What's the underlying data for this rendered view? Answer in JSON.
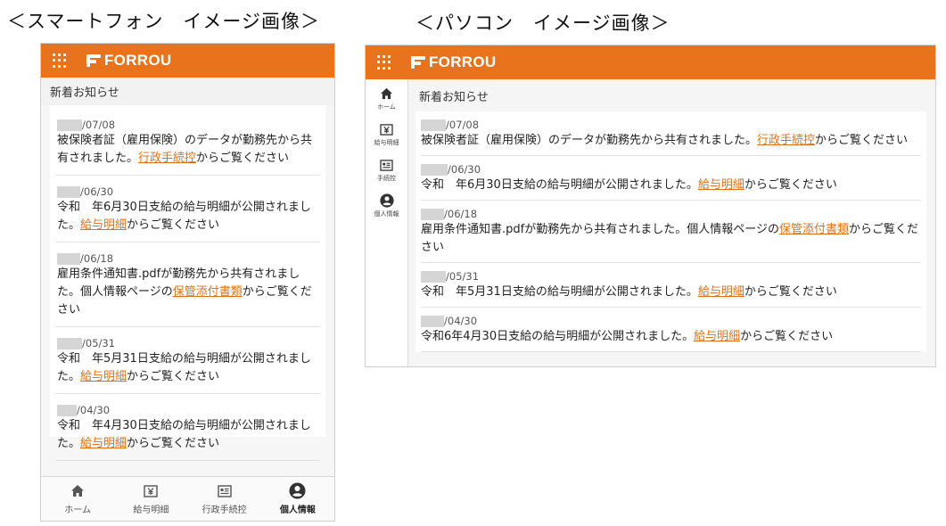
{
  "captions": {
    "mobile": "＜スマートフォン　イメージ画像＞",
    "pc": "＜パソコン　イメージ画像＞"
  },
  "brand": {
    "name": "FORROU",
    "color": "#e8731c"
  },
  "section_title": "新着お知らせ",
  "mobile": {
    "notices": [
      {
        "date": "/07/08",
        "before": "被保険者証（雇用保険）のデータが勤務先から共有されました。",
        "link": "行政手続控",
        "after": "からご覧ください"
      },
      {
        "date": "/06/30",
        "before": "令和　年6月30日支給の給与明細が公開されました。",
        "link": "給与明細",
        "after": "からご覧ください"
      },
      {
        "date": "/06/18",
        "before": "雇用条件通知書.pdfが勤務先から共有されました。個人情報ページの",
        "link": "保管添付書類",
        "after": "からご覧ください"
      },
      {
        "date": "/05/31",
        "before": "令和　年5月31日支給の給与明細が公開されました。",
        "link": "給与明細",
        "after": "からご覧ください"
      },
      {
        "date": "/04/30",
        "before": "令和　年4月30日支給の給与明細が公開されました。",
        "link": "給与明細",
        "after": "からご覧ください"
      }
    ],
    "bottom_nav": [
      {
        "label": "ホーム",
        "icon": "home-icon"
      },
      {
        "label": "給与明細",
        "icon": "yen-icon"
      },
      {
        "label": "行政手続控",
        "icon": "document-icon"
      },
      {
        "label": "個人情報",
        "icon": "person-icon"
      }
    ]
  },
  "pc": {
    "notices": [
      {
        "date": "/07/08",
        "before": "被保険者証（雇用保険）のデータが勤務先から共有されました。",
        "link": "行政手続控",
        "after": "からご覧ください"
      },
      {
        "date": "/06/30",
        "before": "令和　年6月30日支給の給与明細が公開されました。",
        "link": "給与明細",
        "after": "からご覧ください"
      },
      {
        "date": "/06/18",
        "before": "雇用条件通知書.pdfが勤務先から共有されました。個人情報ページの",
        "link": "保管添付書類",
        "after": "からご覧ください"
      },
      {
        "date": "/05/31",
        "before": "令和　年5月31日支給の給与明細が公開されました。",
        "link": "給与明細",
        "after": "からご覧ください"
      },
      {
        "date": "/04/30",
        "before": "令和6年4月30日支給の給与明細が公開されました。",
        "link": "給与明細",
        "after": "からご覧ください"
      }
    ],
    "side_nav": [
      {
        "label": "ホーム",
        "icon": "home-icon"
      },
      {
        "label": "給与明細",
        "icon": "yen-icon"
      },
      {
        "label": "手続控",
        "icon": "document-icon"
      },
      {
        "label": "個人情報",
        "icon": "person-icon"
      }
    ]
  }
}
